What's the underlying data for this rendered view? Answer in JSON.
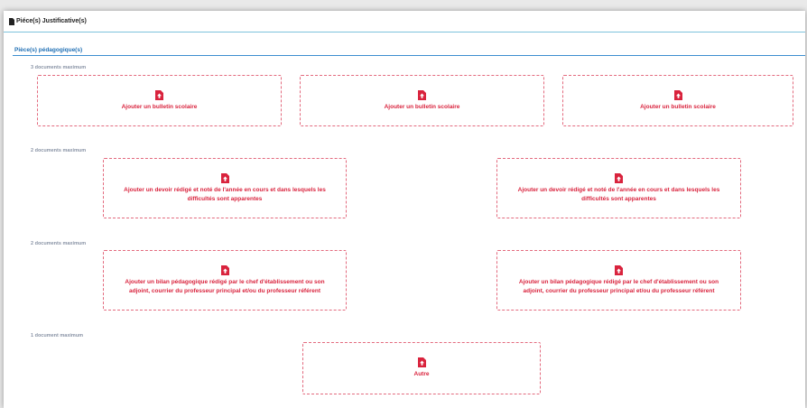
{
  "panel": {
    "title": "Piéce(s) Justificative(s)",
    "section_title": "Pièce(s) pédagogique(s)"
  },
  "colors": {
    "accent_red": "#d9233d",
    "section_blue": "#1f6fb4",
    "header_rule": "#7ec3dc"
  },
  "icons": {
    "header": "document-icon",
    "upload": "file-upload-icon"
  },
  "groups": [
    {
      "limit_label": "3 documents maximum",
      "items": [
        "Ajouter un bulletin scolaire",
        "Ajouter un bulletin scolaire",
        "Ajouter un bulletin scolaire"
      ]
    },
    {
      "limit_label": "2 documents maximum",
      "items": [
        "Ajouter un devoir rédigé et noté de l'année en cours et dans lesquels les difficultés sont apparentes",
        "Ajouter un devoir rédigé et noté de l'année en cours et dans lesquels les difficultés sont apparentes"
      ]
    },
    {
      "limit_label": "2 documents maximum",
      "items": [
        "Ajouter un bilan pédagogique rédigé par le chef d'établissement ou son adjoint, courrier du professeur principal et/ou du professeur référent",
        "Ajouter un bilan pédagogique rédigé par le chef d'établissement ou son adjoint, courrier du professeur principal et/ou du professeur référent"
      ]
    },
    {
      "limit_label": "1 document maximum",
      "items": [
        "Autre"
      ]
    }
  ]
}
